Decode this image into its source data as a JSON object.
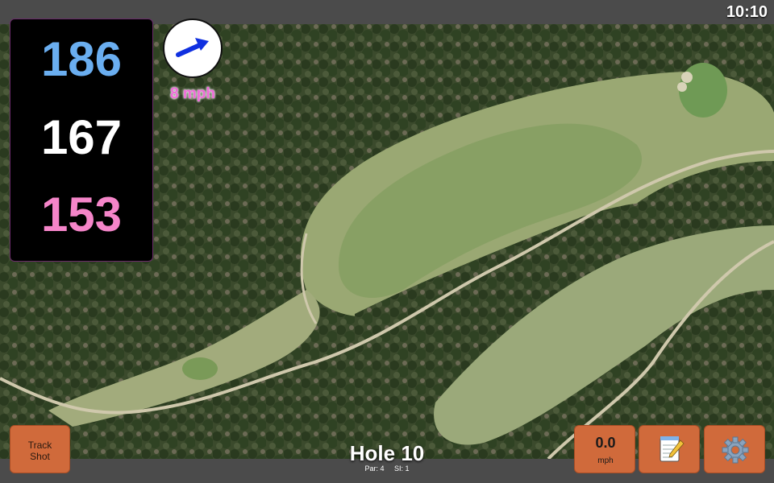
{
  "status_bar": {
    "time": "10:10"
  },
  "distances": {
    "back": "186",
    "middle": "167",
    "front": "153"
  },
  "wind": {
    "speed": "8 mph",
    "direction_icon": "wind-arrow-icon"
  },
  "hole": {
    "title": "Hole 10",
    "par": "Par: 4",
    "si": "SI: 1"
  },
  "buttons": {
    "track_shot_line1": "Track",
    "track_shot_line2": "Shot",
    "speed_value": "0.0",
    "speed_unit": "mph",
    "notes_icon": "notepad-icon",
    "settings_icon": "gear-icon"
  },
  "colors": {
    "back_distance": "#6aaef0",
    "middle_distance": "#ffffff",
    "front_distance": "#f585c9",
    "button": "#d06a3b",
    "wind_text": "#f06bd8"
  }
}
